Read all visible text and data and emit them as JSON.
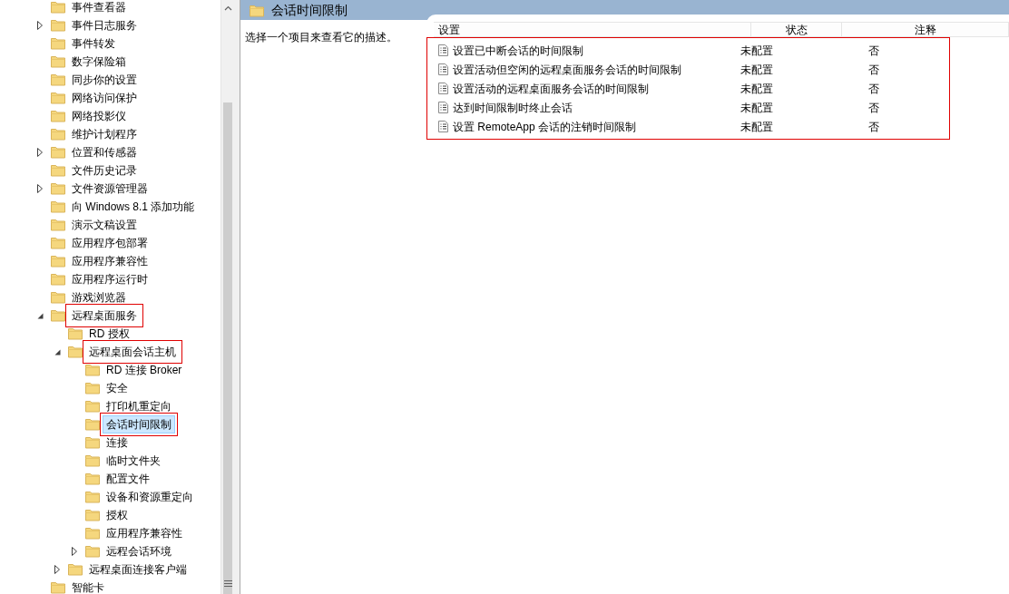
{
  "tree": [
    {
      "label": "事件查看器",
      "selected": false,
      "highlighted": false
    },
    {
      "label": "事件日志服务",
      "expanded": false,
      "selected": false,
      "highlighted": false
    },
    {
      "label": "事件转发",
      "selected": false,
      "highlighted": false
    },
    {
      "label": "数字保险箱",
      "selected": false,
      "highlighted": false
    },
    {
      "label": "同步你的设置",
      "selected": false,
      "highlighted": false
    },
    {
      "label": "网络访问保护",
      "selected": false,
      "highlighted": false
    },
    {
      "label": "网络投影仪",
      "selected": false,
      "highlighted": false
    },
    {
      "label": "维护计划程序",
      "selected": false,
      "highlighted": false
    },
    {
      "label": "位置和传感器",
      "expanded": false,
      "selected": false,
      "highlighted": false
    },
    {
      "label": "文件历史记录",
      "selected": false,
      "highlighted": false
    },
    {
      "label": "文件资源管理器",
      "expanded": false,
      "selected": false,
      "highlighted": false
    },
    {
      "label": "向 Windows 8.1 添加功能",
      "selected": false,
      "highlighted": false
    },
    {
      "label": "演示文稿设置",
      "selected": false,
      "highlighted": false
    },
    {
      "label": "应用程序包部署",
      "selected": false,
      "highlighted": false
    },
    {
      "label": "应用程序兼容性",
      "selected": false,
      "highlighted": false
    },
    {
      "label": "应用程序运行时",
      "selected": false,
      "highlighted": false
    },
    {
      "label": "游戏浏览器",
      "selected": false,
      "highlighted": false
    },
    {
      "label": "远程桌面服务",
      "expanded": true,
      "selected": false,
      "highlighted": true,
      "children": [
        {
          "label": "RD 授权",
          "selected": false,
          "highlighted": false
        },
        {
          "label": "远程桌面会话主机",
          "expanded": true,
          "selected": false,
          "highlighted": true,
          "children": [
            {
              "label": "RD 连接 Broker",
              "selected": false,
              "highlighted": false
            },
            {
              "label": "安全",
              "selected": false,
              "highlighted": false
            },
            {
              "label": "打印机重定向",
              "selected": false,
              "highlighted": false
            },
            {
              "label": "会话时间限制",
              "selected": true,
              "highlighted": true
            },
            {
              "label": "连接",
              "selected": false,
              "highlighted": false
            },
            {
              "label": "临时文件夹",
              "selected": false,
              "highlighted": false
            },
            {
              "label": "配置文件",
              "selected": false,
              "highlighted": false
            },
            {
              "label": "设备和资源重定向",
              "selected": false,
              "highlighted": false
            },
            {
              "label": "授权",
              "selected": false,
              "highlighted": false
            },
            {
              "label": "应用程序兼容性",
              "selected": false,
              "highlighted": false
            },
            {
              "label": "远程会话环境",
              "expanded": false,
              "selected": false,
              "highlighted": false
            }
          ]
        },
        {
          "label": "远程桌面连接客户端",
          "expanded": false,
          "selected": false,
          "highlighted": false
        }
      ]
    },
    {
      "label": "智能卡",
      "selected": false,
      "highlighted": false
    }
  ],
  "panel": {
    "title": "会话时间限制",
    "description": "选择一个项目来查看它的描述。"
  },
  "table": {
    "columns": [
      "设置",
      "状态",
      "注释"
    ],
    "highlighted": true,
    "rows": [
      {
        "setting": "设置已中断会话的时间限制",
        "state": "未配置",
        "comment": "否"
      },
      {
        "setting": "设置活动但空闲的远程桌面服务会话的时间限制",
        "state": "未配置",
        "comment": "否"
      },
      {
        "setting": "设置活动的远程桌面服务会话的时间限制",
        "state": "未配置",
        "comment": "否"
      },
      {
        "setting": "达到时间限制时终止会话",
        "state": "未配置",
        "comment": "否"
      },
      {
        "setting": "设置 RemoteApp 会话的注销时间限制",
        "state": "未配置",
        "comment": "否"
      }
    ]
  }
}
